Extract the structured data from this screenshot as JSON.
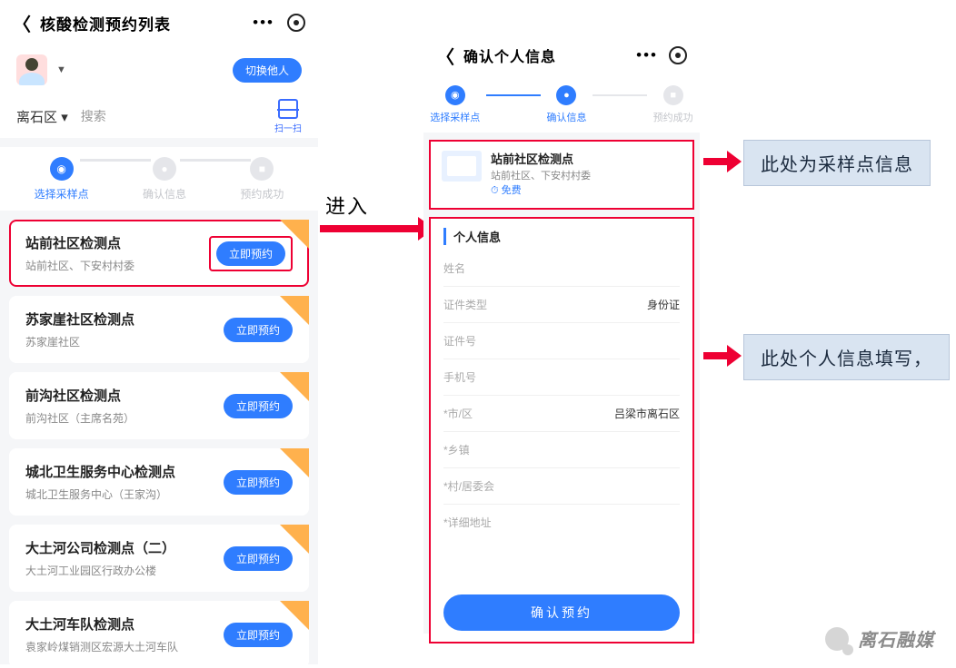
{
  "left": {
    "header_title": "核酸检测预约列表",
    "switch_user_label": "切换他人",
    "area_label": "离石区",
    "area_caret": "▾",
    "search_placeholder": "搜索",
    "scan_label": "扫一扫",
    "steps": {
      "s1": "选择采样点",
      "s2": "确认信息",
      "s3": "预约成功"
    },
    "items": [
      {
        "name": "站前社区检测点",
        "sub": "站前社区、下安村村委",
        "btn": "立即预约"
      },
      {
        "name": "苏家崖社区检测点",
        "sub": "苏家崖社区",
        "btn": "立即预约"
      },
      {
        "name": "前沟社区检测点",
        "sub": "前沟社区（主席名苑）",
        "btn": "立即预约"
      },
      {
        "name": "城北卫生服务中心检测点",
        "sub": "城北卫生服务中心（王家沟）",
        "btn": "立即预约"
      },
      {
        "name": "大土河公司检测点（二）",
        "sub": "大土河工业园区行政办公楼",
        "btn": "立即预约"
      },
      {
        "name": "大土河车队检测点",
        "sub": "袁家岭煤销测区宏源大土河车队",
        "btn": "立即预约"
      }
    ]
  },
  "enter_label": "进入",
  "center": {
    "header_title": "确认个人信息",
    "steps": {
      "s1": "选择采样点",
      "s2": "确认信息",
      "s3": "预约成功"
    },
    "sample": {
      "name": "站前社区检测点",
      "addr": "站前社区、下安村村委",
      "free_label": "免费",
      "clock": "⏱"
    },
    "form": {
      "title": "个人信息",
      "fields": {
        "name": "姓名",
        "idtype": "证件类型",
        "idtype_val": "身份证",
        "idno": "证件号",
        "phone": "手机号",
        "city": "*市/区",
        "city_val": "吕梁市离石区",
        "town": "*乡镇",
        "village": "*村/居委会",
        "addr": "*详细地址"
      },
      "submit": "确认预约"
    }
  },
  "anno": {
    "a1": "此处为采样点信息",
    "a2": "此处个人信息填写，"
  },
  "watermark": "离石融媒"
}
